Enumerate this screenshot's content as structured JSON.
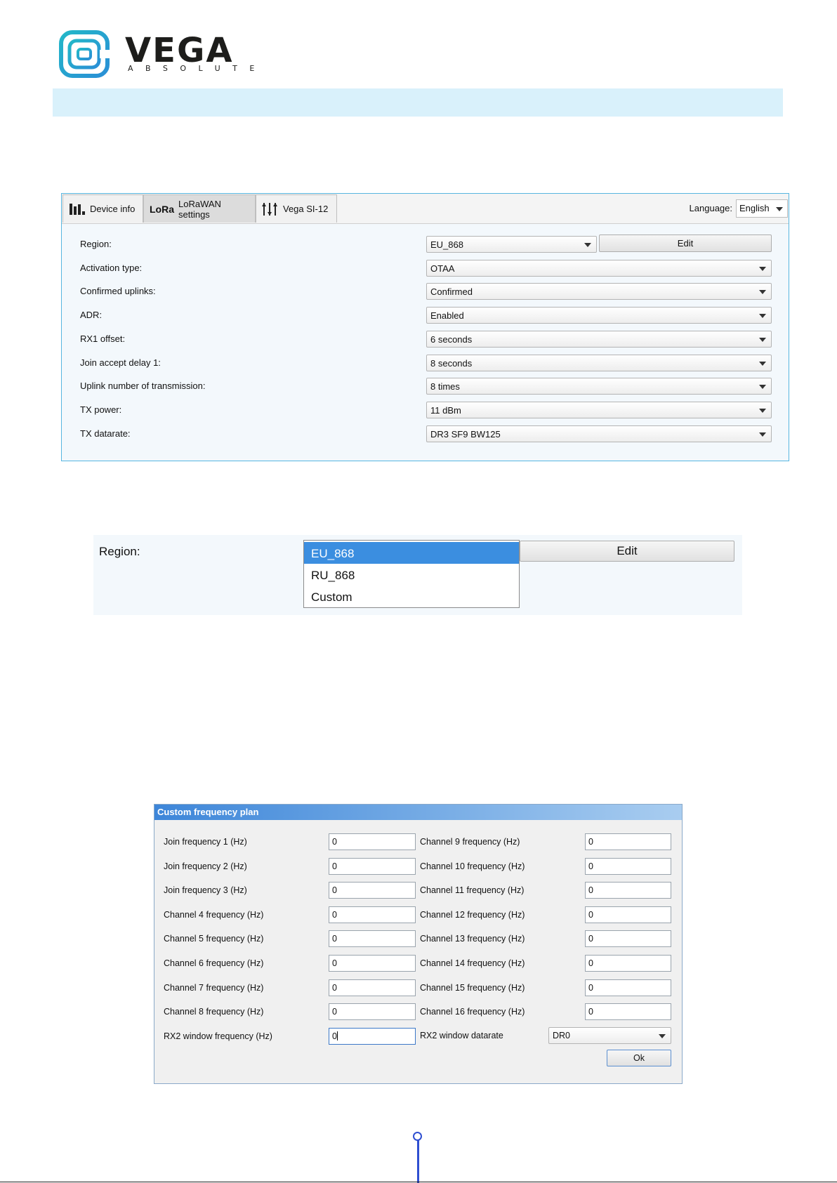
{
  "brand": {
    "name": "VEGA",
    "tagline": "ABSOLUTE",
    "logo_colors": [
      "#23b7c8",
      "#2a8fd6"
    ]
  },
  "tabs": [
    {
      "label": "Device info",
      "icon": "bar-chart-icon",
      "active": false
    },
    {
      "label": "LoRaWAN settings",
      "icon": "lora-icon",
      "icon_text": "LoRa",
      "active": true
    },
    {
      "label": "Vega SI-12",
      "icon": "sliders-icon",
      "active": false
    }
  ],
  "language": {
    "label": "Language:",
    "value": "English"
  },
  "settings": [
    {
      "label": "Region:",
      "value": "EU_868"
    },
    {
      "label": "Activation type:",
      "value": "OTAA"
    },
    {
      "label": "Confirmed uplinks:",
      "value": "Confirmed"
    },
    {
      "label": "ADR:",
      "value": "Enabled"
    },
    {
      "label": "RX1 offset:",
      "value": "6 seconds"
    },
    {
      "label": "Join accept delay 1:",
      "value": "8 seconds"
    },
    {
      "label": "Uplink number of transmission:",
      "value": "8 times"
    },
    {
      "label": "TX power:",
      "value": "11 dBm"
    },
    {
      "label": "TX datarate:",
      "value": "DR3 SF9 BW125"
    }
  ],
  "edit_label": "Edit",
  "region_dropdown": {
    "label": "Region:",
    "options": [
      "EU_868",
      "RU_868",
      "Custom"
    ],
    "selected": "EU_868",
    "edit_label": "Edit"
  },
  "dialog": {
    "title": "Custom frequency plan",
    "left": [
      {
        "label": "Join frequency 1 (Hz)",
        "value": "0"
      },
      {
        "label": "Join frequency 2 (Hz)",
        "value": "0"
      },
      {
        "label": "Join frequency 3 (Hz)",
        "value": "0"
      },
      {
        "label": "Channel 4 frequency (Hz)",
        "value": "0"
      },
      {
        "label": "Channel 5 frequency (Hz)",
        "value": "0"
      },
      {
        "label": "Channel 6 frequency (Hz)",
        "value": "0"
      },
      {
        "label": "Channel 7 frequency (Hz)",
        "value": "0"
      },
      {
        "label": "Channel 8 frequency (Hz)",
        "value": "0"
      },
      {
        "label": "RX2 window frequency (Hz)",
        "value": "0"
      }
    ],
    "right": [
      {
        "label": "Channel 9 frequency (Hz)",
        "value": "0"
      },
      {
        "label": "Channel 10 frequency (Hz)",
        "value": "0"
      },
      {
        "label": "Channel 11 frequency (Hz)",
        "value": "0"
      },
      {
        "label": "Channel 12 frequency (Hz)",
        "value": "0"
      },
      {
        "label": "Channel 13 frequency (Hz)",
        "value": "0"
      },
      {
        "label": "Channel 14 frequency (Hz)",
        "value": "0"
      },
      {
        "label": "Channel 15 frequency (Hz)",
        "value": "0"
      },
      {
        "label": "Channel 16 frequency (Hz)",
        "value": "0"
      }
    ],
    "rx2_datarate": {
      "label": "RX2 window datarate",
      "value": "DR0"
    },
    "ok_label": "Ok"
  }
}
